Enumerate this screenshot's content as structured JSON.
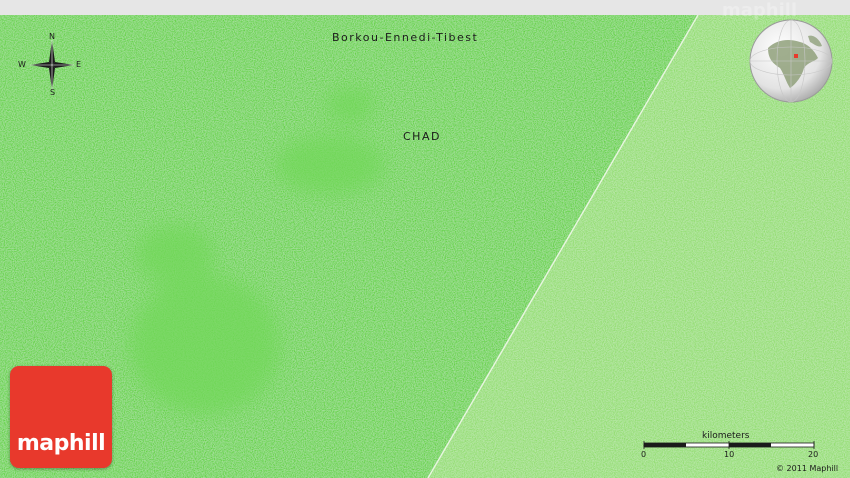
{
  "labels": {
    "region": "Borkou-Ennedi-Tibest",
    "country": "CHAD"
  },
  "compass": {
    "north": "N",
    "south": "S",
    "east": "E",
    "west": "W"
  },
  "logo": {
    "text": "maphill"
  },
  "watermark": "maphill",
  "scale": {
    "unit_label": "kilometers",
    "ticks": [
      "0",
      "10",
      "20"
    ]
  },
  "copyright": "© 2011 Maphill",
  "colors": {
    "land_primary": "#5fd13a",
    "land_secondary": "#8fdd6a",
    "border_line": "#e8f5e0",
    "logo_red": "#e8392c"
  }
}
